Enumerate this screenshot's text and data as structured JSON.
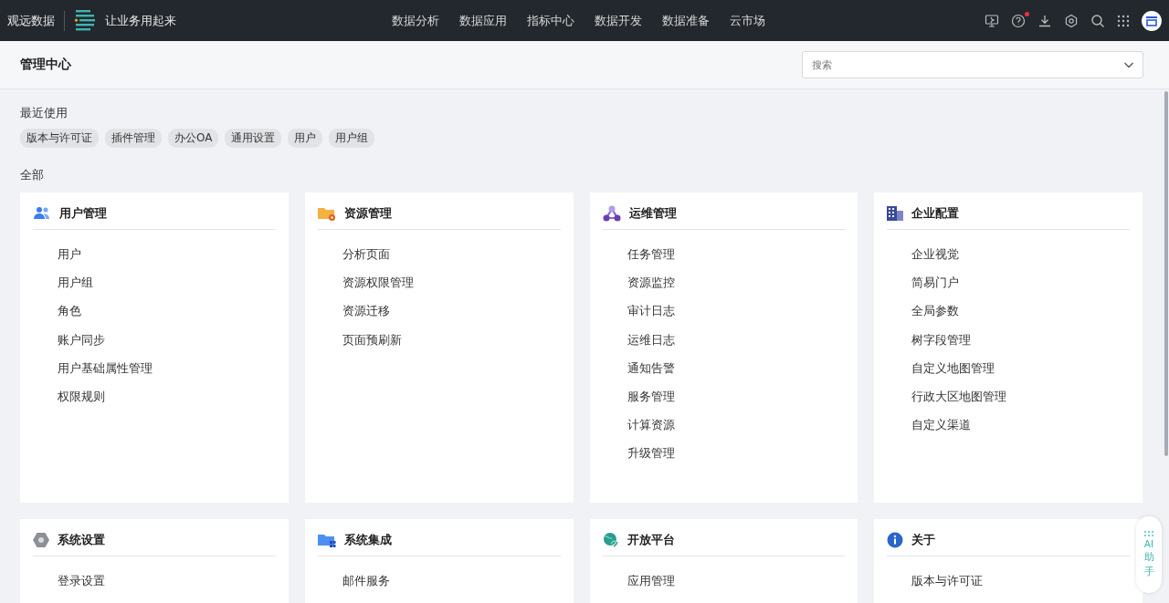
{
  "topbar": {
    "brand": "观远数据",
    "slogan": "让业务用起来",
    "nav": [
      {
        "label": "数据分析",
        "selected": false
      },
      {
        "label": "数据应用",
        "selected": false
      },
      {
        "label": "指标中心",
        "selected": false
      },
      {
        "label": "数据开发",
        "selected": false
      },
      {
        "label": "数据准备",
        "selected": false
      },
      {
        "label": "云市场",
        "selected": false
      }
    ],
    "help_notification": true
  },
  "header": {
    "title": "管理中心",
    "search": {
      "placeholder": "搜索"
    }
  },
  "recent": {
    "title": "最近使用",
    "tags": [
      "版本与许可证",
      "插件管理",
      "办公OA",
      "通用设置",
      "用户",
      "用户组"
    ]
  },
  "all": {
    "title": "全部",
    "cards": [
      {
        "kind": "users",
        "title": "用户管理",
        "items": [
          "用户",
          "用户组",
          "角色",
          "账户同步",
          "用户基础属性管理",
          "权限规则"
        ]
      },
      {
        "kind": "folder-gear",
        "title": "资源管理",
        "items": [
          "分析页面",
          "资源权限管理",
          "资源迁移",
          "页面预刷新"
        ]
      },
      {
        "kind": "network",
        "title": "运维管理",
        "items": [
          "任务管理",
          "资源监控",
          "审计日志",
          "运维日志",
          "通知告警",
          "服务管理",
          "计算资源",
          "升级管理"
        ]
      },
      {
        "kind": "building",
        "title": "企业配置",
        "items": [
          "企业视觉",
          "简易门户",
          "全局参数",
          "树字段管理",
          "自定义地图管理",
          "行政大区地图管理",
          "自定义渠道"
        ]
      },
      {
        "kind": "hexagon",
        "title": "系统设置",
        "items": [
          "登录设置"
        ]
      },
      {
        "kind": "folder-grid",
        "title": "系统集成",
        "items": [
          "邮件服务"
        ]
      },
      {
        "kind": "globe",
        "title": "开放平台",
        "items": [
          "应用管理"
        ]
      },
      {
        "kind": "info",
        "title": "关于",
        "items": [
          "版本与许可证"
        ]
      }
    ]
  },
  "assistant": {
    "label": [
      "AI",
      "助",
      "手"
    ]
  }
}
